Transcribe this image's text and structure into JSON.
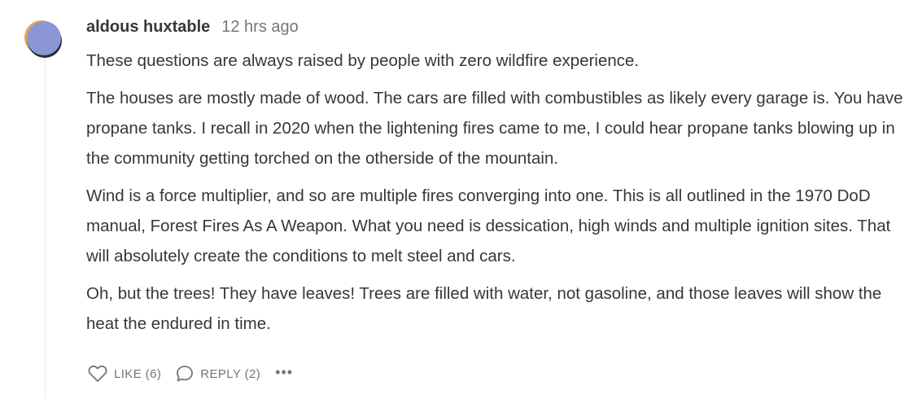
{
  "comment": {
    "author": "aldous huxtable",
    "timestamp": "12 hrs ago",
    "paragraphs": [
      "These questions are always raised by people with zero wildfire experience.",
      "The houses are mostly made of wood. The cars are filled with combustibles as likely every garage is. You have propane tanks. I recall in 2020 when the lightening fires came to me, I could hear propane tanks blowing up in the community getting torched on the otherside of the mountain.",
      "Wind is a force multiplier, and so are multiple fires converging into one. This is all outlined in the 1970 DoD manual, Forest Fires As A Weapon. What you need is dessication, high winds and multiple ignition sites. That will absolutely create the conditions to melt steel and cars.",
      "Oh, but the trees! They have leaves! Trees are filled with water, not gasoline, and those leaves will show the heat the endured in time."
    ],
    "avatar_colors": {
      "front": "#8b96d6",
      "shadow_dark": "#2b2b2b",
      "shadow_green": "#3a9a6b",
      "shadow_orange": "#f0a24a"
    }
  },
  "actions": {
    "like_label": "LIKE (6)",
    "reply_label": "REPLY (2)",
    "more_label": "•••",
    "like_icon": "heart-icon",
    "reply_icon": "speech-bubble-icon"
  }
}
